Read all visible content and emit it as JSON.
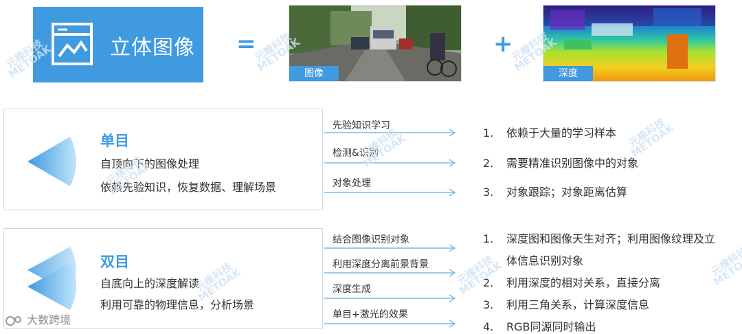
{
  "top": {
    "title": "立体图像",
    "equals": "=",
    "plus": "+",
    "image_tag": "图像",
    "depth_tag": "深度"
  },
  "monocular": {
    "title": "单目",
    "line1": "自顶向下的图像处理",
    "line2": "依赖先验知识，恢复数据、理解场景",
    "steps": [
      "先验知识学习",
      "检测&识别",
      "对象处理"
    ],
    "results": [
      {
        "num": "1.",
        "text": "依赖于大量的学习样本"
      },
      {
        "num": "2.",
        "text": "需要精准识别图像中的对象"
      },
      {
        "num": "3.",
        "text": "对象跟踪；对象距离估算"
      }
    ]
  },
  "binocular": {
    "title": "双目",
    "line1": "自底向上的深度解读",
    "line2": "利用可靠的物理信息，分析场景",
    "steps": [
      "结合图像识别对象",
      "利用深度分离前景背景",
      "深度生成",
      "单目+激光的效果"
    ],
    "results": [
      {
        "num": "1.",
        "text": "深度图和图像天生对齐；利用图像纹理及立"
      },
      {
        "num": "",
        "text": "体信息识别对象"
      },
      {
        "num": "2.",
        "text": "利用深度的相对关系，直接分离"
      },
      {
        "num": "3.",
        "text": "利用三角关系，计算深度信息"
      },
      {
        "num": "4.",
        "text": "RGB同源同时输出"
      }
    ]
  },
  "watermark": {
    "cn": "元橡科技",
    "en": "METOAK"
  },
  "brand": "大数跨境",
  "colors": {
    "accent": "#3f9ae0",
    "arrow": "#5aaee6"
  }
}
